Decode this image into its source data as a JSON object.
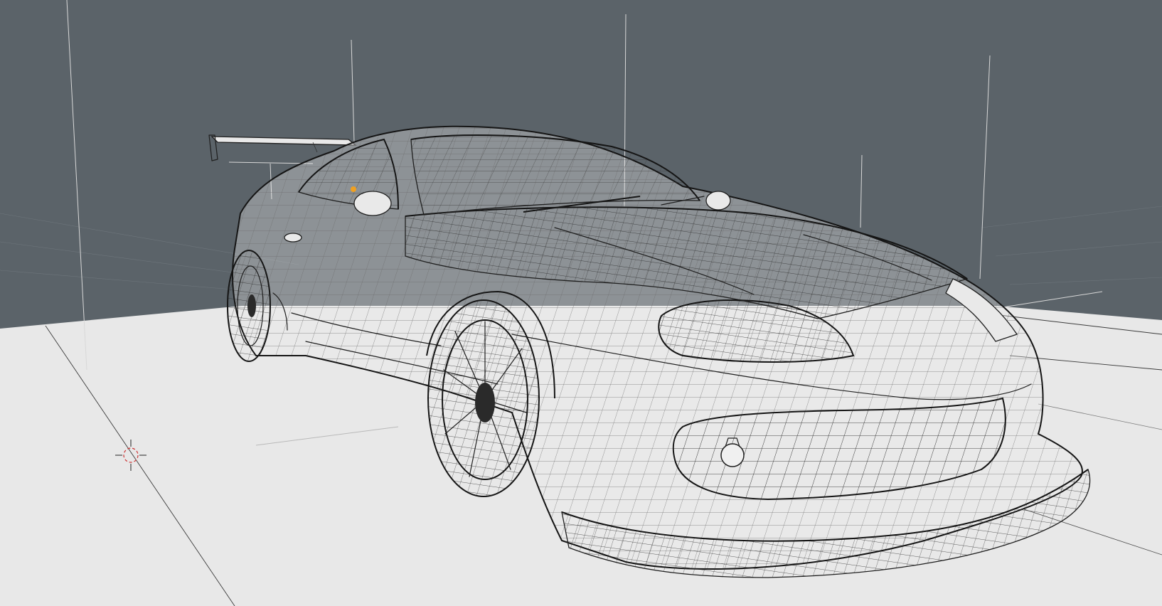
{
  "viewport": {
    "mode": "wireframe",
    "background_color": "#5b6369",
    "floor_color": "#e8e8e8",
    "wire_color": "#1f1f1f",
    "selection_color": "#f0a020"
  },
  "scene": {
    "subject": "car-wireframe-model",
    "origin_marker": "3d-cursor-icon",
    "selected_vertex": "selected-vertex-marker"
  }
}
